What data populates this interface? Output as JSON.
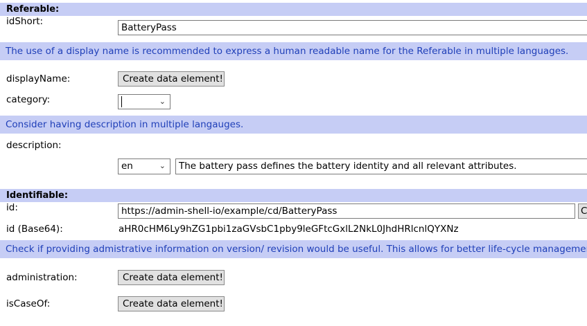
{
  "referable": {
    "header": "Referable:",
    "idShort_label": "idShort:",
    "idShort_value": "BatteryPass",
    "hint_display": "The use of a display name is recommended to express a human readable name for the Referable in multiple languages.",
    "displayName_label": "displayName:",
    "displayName_button": "Create data element!",
    "category_label": "category:",
    "category_value": "",
    "hint_description": "Consider having description in multiple langauges.",
    "description_label": "description:",
    "description_lang": "en",
    "description_text": "The battery pass defines the battery identity and all relevant attributes."
  },
  "identifiable": {
    "header": "Identifiable:",
    "id_label": "id:",
    "id_value": "https://admin-shell-io/example/cd/BatteryPass",
    "id_button_partial": "C",
    "id64_label": "id (Base64):",
    "id64_value": "aHR0cHM6Ly9hZG1pbi1zaGVsbC1pby9leGFtcGxlL2NkL0JhdHRlcnlQYXNz",
    "hint_admin": "Check if providing admistrative information on version/ revision would be useful. This allows for better life-cycle management.",
    "administration_label": "administration:",
    "administration_button": "Create data element!",
    "isCaseOf_label": "isCaseOf:",
    "isCaseOf_button": "Create data element!"
  },
  "icons": {
    "dropdown": "chevron-down-icon"
  },
  "colors": {
    "header_bg": "#c6cdf5",
    "hint_text": "#1f3fb8"
  }
}
